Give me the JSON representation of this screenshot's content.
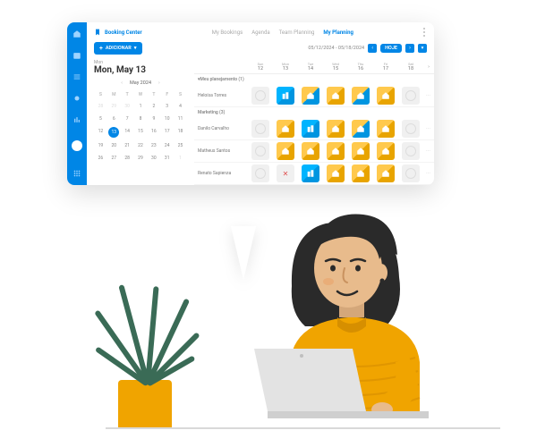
{
  "app": {
    "title": "Booking Center"
  },
  "tabs": [
    {
      "label": "My Bookings",
      "active": false
    },
    {
      "label": "Agenda",
      "active": false
    },
    {
      "label": "Team Planning",
      "active": false
    },
    {
      "label": "My Planning",
      "active": true
    }
  ],
  "addButton": {
    "label": "ADICIONAR"
  },
  "dateRange": "05/12/2024 - 05/18/2024",
  "todayButton": "HOJE",
  "calendar": {
    "weekdayShort": "Mon",
    "fullDate": "Mon, May 13",
    "monthLabel": "May 2024",
    "dow": [
      "S",
      "M",
      "T",
      "W",
      "T",
      "F",
      "S"
    ],
    "weeks": [
      [
        "28",
        "29",
        "30",
        "1",
        "2",
        "3",
        "4"
      ],
      [
        "5",
        "6",
        "7",
        "8",
        "9",
        "10",
        "11"
      ],
      [
        "12",
        "13",
        "14",
        "15",
        "16",
        "17",
        "18"
      ],
      [
        "19",
        "20",
        "21",
        "22",
        "23",
        "24",
        "25"
      ],
      [
        "26",
        "27",
        "28",
        "29",
        "30",
        "31",
        "1"
      ]
    ],
    "mutedStart": 3,
    "mutedEndIndex": 34,
    "today": "13"
  },
  "planningHeader": [
    {
      "dow": "Sun",
      "num": "12"
    },
    {
      "dow": "Mon",
      "num": "13"
    },
    {
      "dow": "Tue",
      "num": "14"
    },
    {
      "dow": "Wed",
      "num": "15"
    },
    {
      "dow": "Thu",
      "num": "16"
    },
    {
      "dow": "Fri",
      "num": "17"
    },
    {
      "dow": "Sat",
      "num": "18"
    }
  ],
  "groups": [
    {
      "label": "▾Meu planejamento (1)",
      "rows": [
        {
          "name": "Heloísa Torres",
          "slots": [
            "blank",
            "office",
            "home-blue",
            "home",
            "home-blue",
            "home",
            "blank"
          ]
        }
      ]
    },
    {
      "label": "Marketing (3)",
      "rows": [
        {
          "name": "Danilo Carvalho",
          "slots": [
            "blank",
            "home",
            "office",
            "home",
            "home-blue",
            "home",
            "blank"
          ]
        },
        {
          "name": "Matheus Santos",
          "slots": [
            "blank",
            "home",
            "home",
            "home",
            "home",
            "home",
            "blank"
          ]
        },
        {
          "name": "Renato Sapienza",
          "slots": [
            "blank",
            "blocked",
            "office",
            "home",
            "home",
            "home",
            "blank"
          ]
        }
      ]
    }
  ]
}
